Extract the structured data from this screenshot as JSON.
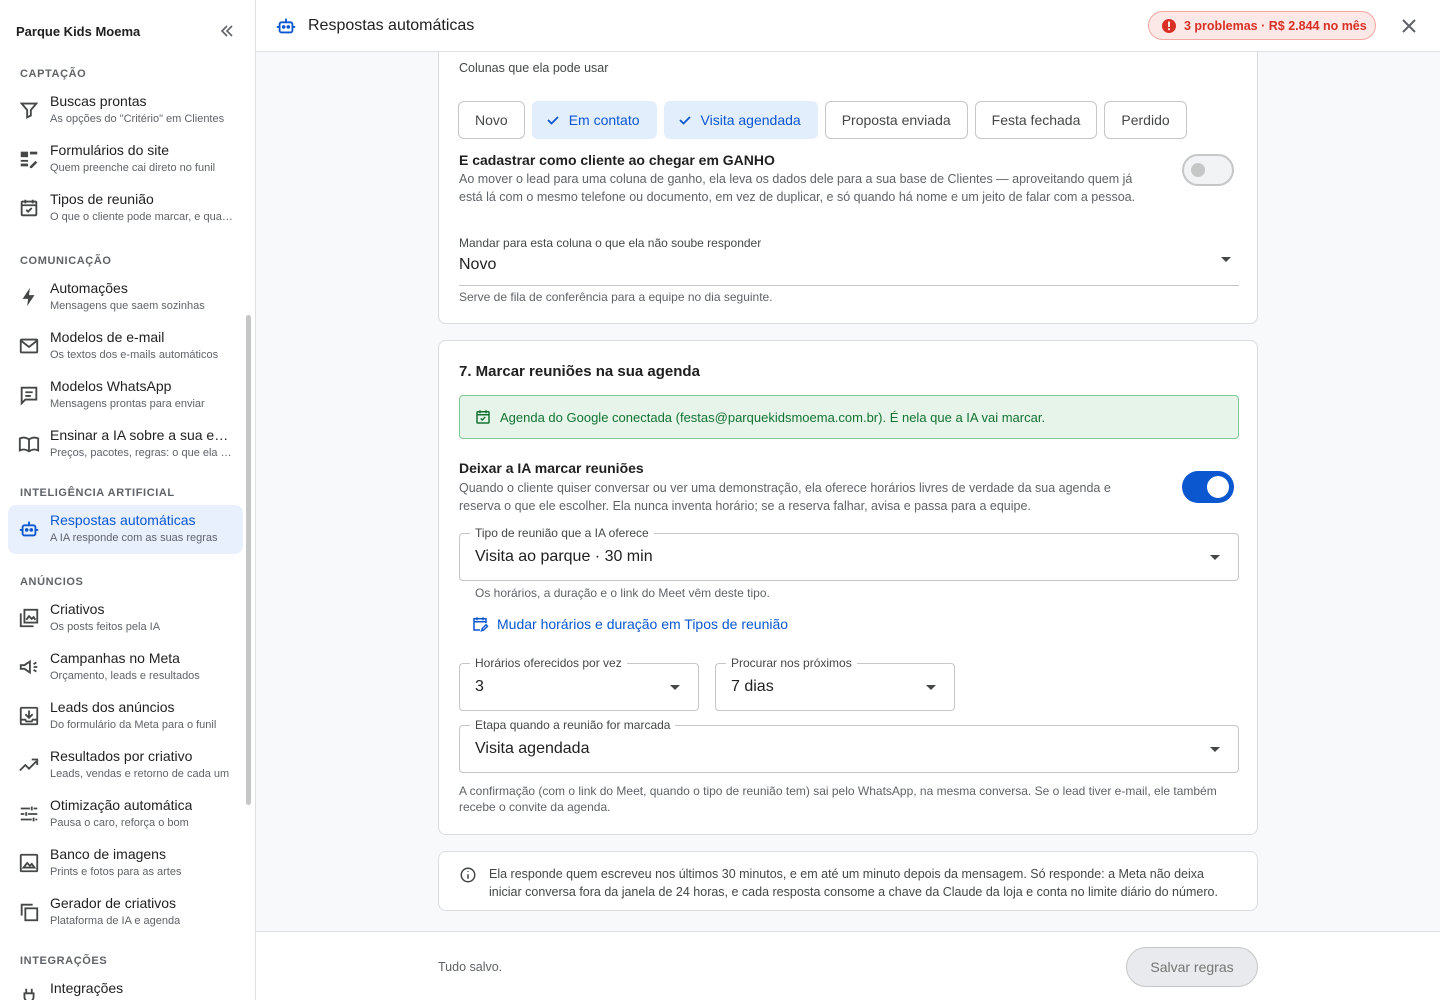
{
  "app": {
    "store_name": "Parque Kids Moema",
    "page_title": "Respostas automáticas",
    "problems_badge": "3 problemas · R$ 2.844 no mês"
  },
  "sidebar": {
    "sections": [
      {
        "title": "CAPTAÇÃO",
        "items": [
          {
            "label": "Buscas prontas",
            "sub": "As opções do \"Critério\" em Clientes",
            "icon": "filter-icon"
          },
          {
            "label": "Formulários do site",
            "sub": "Quem preenche cai direto no funil",
            "icon": "form-icon"
          },
          {
            "label": "Tipos de reunião",
            "sub": "O que o cliente pode marcar, e quanto dura",
            "icon": "calendar-check-icon"
          }
        ]
      },
      {
        "title": "COMUNICAÇÃO",
        "items": [
          {
            "label": "Automações",
            "sub": "Mensagens que saem sozinhas",
            "icon": "bolt-icon"
          },
          {
            "label": "Modelos de e-mail",
            "sub": "Os textos dos e-mails automáticos",
            "icon": "mail-icon"
          },
          {
            "label": "Modelos WhatsApp",
            "sub": "Mensagens prontas para enviar",
            "icon": "chat-icon"
          },
          {
            "label": "Ensinar a IA sobre a sua empresa",
            "sub": "Preços, pacotes, regras: o que ela precisa saber",
            "icon": "book-icon"
          }
        ]
      },
      {
        "title": "INTELIGÊNCIA ARTIFICIAL",
        "items": [
          {
            "label": "Respostas automáticas",
            "sub": "A IA responde com as suas regras",
            "icon": "robot-icon",
            "active": true
          }
        ]
      },
      {
        "title": "ANÚNCIOS",
        "items": [
          {
            "label": "Criativos",
            "sub": "Os posts feitos pela IA",
            "icon": "image-stack-icon"
          },
          {
            "label": "Campanhas no Meta",
            "sub": "Orçamento, leads e resultados",
            "icon": "megaphone-icon"
          },
          {
            "label": "Leads dos anúncios",
            "sub": "Do formulário da Meta para o funil",
            "icon": "inbox-download-icon"
          },
          {
            "label": "Resultados por criativo",
            "sub": "Leads, vendas e retorno de cada um",
            "icon": "trending-icon"
          },
          {
            "label": "Otimização automática",
            "sub": "Pausa o caro, reforça o bom",
            "icon": "tune-icon"
          },
          {
            "label": "Banco de imagens",
            "sub": "Prints e fotos para as artes",
            "icon": "photo-icon"
          },
          {
            "label": "Gerador de criativos",
            "sub": "Plataforma de IA e agenda",
            "icon": "copy-icon"
          }
        ]
      },
      {
        "title": "INTEGRAÇÕES",
        "items": [
          {
            "label": "Integrações",
            "sub": "",
            "icon": "plug-icon"
          }
        ]
      }
    ]
  },
  "section6": {
    "columns_caption": "Colunas que ela pode usar",
    "columns": [
      {
        "label": "Novo",
        "selected": false
      },
      {
        "label": "Em contato",
        "selected": true
      },
      {
        "label": "Visita agendada",
        "selected": true
      },
      {
        "label": "Proposta enviada",
        "selected": false
      },
      {
        "label": "Festa fechada",
        "selected": false
      },
      {
        "label": "Perdido",
        "selected": false
      }
    ],
    "client_toggle_title": "E cadastrar como cliente ao chegar em GANHO",
    "client_toggle_desc": "Ao mover o lead para uma coluna de ganho, ela leva os dados dele para a sua base de Clientes — aproveitando quem já está lá com o mesmo telefone ou documento, em vez de duplicar, e só quando há nome e um jeito de falar com a pessoa.",
    "client_toggle_on": false,
    "fallback_label": "Mandar para esta coluna o que ela não soube responder",
    "fallback_value": "Novo",
    "fallback_helper": "Serve de fila de conferência para a equipe no dia seguinte."
  },
  "section7": {
    "title": "7. Marcar reuniões na sua agenda",
    "banner": "Agenda do Google conectada (festas@parquekidsmoema.com.br). É nela que a IA vai marcar.",
    "meeting_toggle_title": "Deixar a IA marcar reuniões",
    "meeting_toggle_desc": "Quando o cliente quiser conversar ou ver uma demonstração, ela oferece horários livres de verdade da sua agenda e reserva o que ele escolher. Ela nunca inventa horário; se a reserva falhar, avisa e passa para a equipe.",
    "meeting_toggle_on": true,
    "meeting_type_label": "Tipo de reunião que a IA oferece",
    "meeting_type_value": "Visita ao parque · 30 min",
    "meeting_type_helper": "Os horários, a duração e o link do Meet vêm deste tipo.",
    "change_link": "Mudar horários e duração em Tipos de reunião",
    "slots_label": "Horários oferecidos por vez",
    "slots_value": "3",
    "range_label": "Procurar nos próximos",
    "range_value": "7 dias",
    "stage_label": "Etapa quando a reunião for marcada",
    "stage_value": "Visita agendada",
    "confirmation_note": "A confirmação (com o link do Meet, quando o tipo de reunião tem) sai pelo WhatsApp, na mesma conversa. Se o lead tiver e-mail, ele também recebe o convite da agenda."
  },
  "info_note": "Ela responde quem escreveu nos últimos 30 minutos, e em até um minuto depois da mensagem. Só responde: a Meta não deixa iniciar conversa fora da janela de 24 horas, e cada resposta consome a chave da Claude da loja e conta no limite diário do número.",
  "footer": {
    "status": "Tudo salvo.",
    "save_label": "Salvar regras"
  },
  "colors": {
    "accent": "#0b57d0",
    "active_bg": "#e8f0fe",
    "error": "#d93025",
    "success_bg": "#e6f4ea",
    "success_text": "#137333"
  }
}
